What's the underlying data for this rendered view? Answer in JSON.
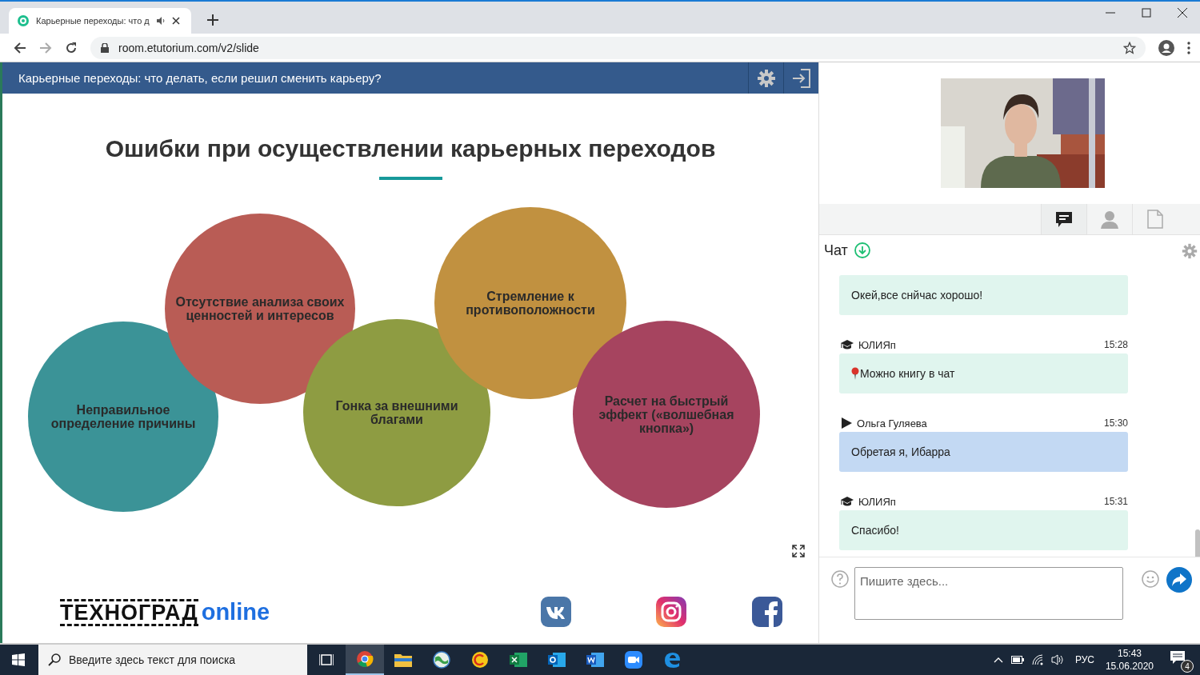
{
  "browser": {
    "tab_title": "Карьерные переходы: что д",
    "url": "room.etutorium.com/v2/slide"
  },
  "header": {
    "title": "Карьерные переходы: что делать, если решил сменить карьеру?"
  },
  "slide": {
    "title": "Ошибки при осуществлении карьерных переходов",
    "circles": [
      {
        "label": "Неправильное определение причины",
        "color": "#3b9397"
      },
      {
        "label": "Отсутствие анализа своих ценностей и интересов",
        "color": "#b95c55"
      },
      {
        "label": "Гонка за внешними благами",
        "color": "#8e9c42"
      },
      {
        "label": "Стремление к противоположности",
        "color": "#c19140"
      },
      {
        "label": "Расчет на быстрый эффект («волшебная кнопка»)",
        "color": "#a6445f"
      }
    ],
    "logo": {
      "word": "ТЕХНОГРАД",
      "suffix": "online"
    }
  },
  "panel_tabs": [
    {
      "kind": "chat",
      "selected": true
    },
    {
      "kind": "user",
      "selected": false
    },
    {
      "kind": "file",
      "selected": false
    }
  ],
  "chat": {
    "title": "Чат",
    "messages": [
      {
        "kind": "teacher",
        "text": "Окей,все снйчас хорошо!",
        "pin": false
      },
      {
        "kind": "teacher",
        "sender": "ЮЛИЯп",
        "time": "15:28",
        "text": "Можно книгу в чат",
        "pin": true
      },
      {
        "kind": "student",
        "sender": "Ольга Гуляева",
        "time": "15:30",
        "text": "Обретая я, Ибарра",
        "pin": false
      },
      {
        "kind": "teacher",
        "sender": "ЮЛИЯп",
        "time": "15:31",
        "text": "Спасибо!",
        "pin": false
      }
    ],
    "input": {
      "placeholder": "Пишите здесь..."
    }
  },
  "taskbar": {
    "search": {
      "placeholder": "Введите здесь текст для поиска"
    },
    "apps": [
      {
        "kind": "taskview",
        "selected": false
      },
      {
        "kind": "chrome",
        "selected": true
      },
      {
        "kind": "explorer",
        "selected": false
      },
      {
        "kind": "globe",
        "selected": false
      },
      {
        "kind": "onec",
        "selected": false
      },
      {
        "kind": "excel",
        "selected": false
      },
      {
        "kind": "outlook",
        "selected": false
      },
      {
        "kind": "word",
        "selected": false
      },
      {
        "kind": "zoom",
        "selected": false
      },
      {
        "kind": "edge",
        "selected": false
      }
    ],
    "language": "РУС",
    "time": "15:43",
    "date": "15.06.2020",
    "notifications": "4"
  }
}
